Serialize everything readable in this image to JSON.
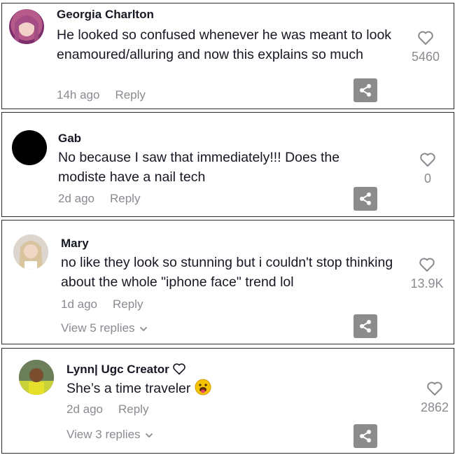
{
  "comments": [
    {
      "username": "Georgia Charlton",
      "text": "He looked so confused whenever he was meant to look enamoured/alluring and now this explains so much",
      "time": "14h ago",
      "reply_label": "Reply",
      "likes": "5460"
    },
    {
      "username": "Gab",
      "text": "No because I saw that immediately!!! Does the modiste have a nail tech",
      "time": "2d ago",
      "reply_label": "Reply",
      "likes": "0"
    },
    {
      "username": "Mary",
      "text": "no like they look so stunning but i couldn't stop thinking about the whole \"iphone face\" trend lol",
      "time": "1d ago",
      "reply_label": "Reply",
      "likes": "13.9K",
      "view_replies": "View 5 replies"
    },
    {
      "username": "Lynn| Ugc Creator",
      "text": "She’s a time traveler",
      "time": "2d ago",
      "reply_label": "Reply",
      "likes": "2862",
      "view_replies": "View 3 replies"
    }
  ],
  "colors": {
    "muted": "#8a8b91",
    "share_bg": "#8c8c8c",
    "border": "#2a2a2a"
  }
}
